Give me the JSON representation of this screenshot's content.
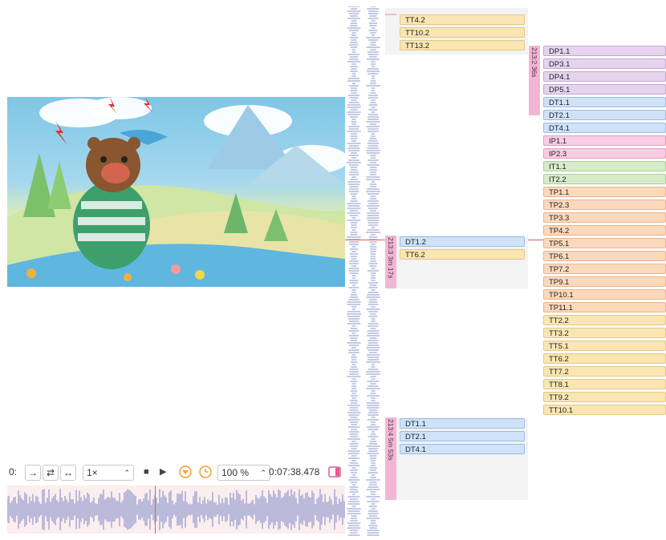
{
  "controls": {
    "channel_label": "0:",
    "arrow_right": "→",
    "loop_icon": "⇄",
    "expand_icon": "↔",
    "rate_value": "1×",
    "rate_chevron": "⌃",
    "stop_icon": "■",
    "play_icon": "▶",
    "zoom_value": "100 %",
    "zoom_chevron": "⌃",
    "timecode": "0:07:38.478"
  },
  "colors": {
    "accent_orange": "#f0a030",
    "playhead": "#e0605a"
  },
  "segments": [
    {
      "label": "213:2 36s"
    },
    {
      "label": "213:3 3m 17s"
    },
    {
      "label": "213:4 5m 53s"
    }
  ],
  "tracks_col1_top": [
    "TT4.2",
    "TT10.2",
    "TT13.2"
  ],
  "tracks_col2": [
    "DP1.1",
    "DP3.1",
    "DP4.1",
    "DP5.1",
    "DT1.1",
    "DT2.1",
    "DT4.1",
    "IP1.1",
    "IP2.3",
    "IT1.1",
    "IT2.2",
    "TP1.1",
    "TP2.3",
    "TP3.3",
    "TP4.2",
    "TP5.1",
    "TP6.1",
    "TP7.2",
    "TP9.1",
    "TP10.1",
    "TP11.1",
    "TT2.2",
    "TT3.2",
    "TT5.1",
    "TT6.2",
    "TT7.2",
    "TT8.1",
    "TT9.2",
    "TT10.1"
  ],
  "tracks_seg3": [
    "DT1.2",
    "TT6.2"
  ],
  "tracks_seg4": [
    "DT1.1",
    "DT2.1",
    "DT4.1"
  ]
}
